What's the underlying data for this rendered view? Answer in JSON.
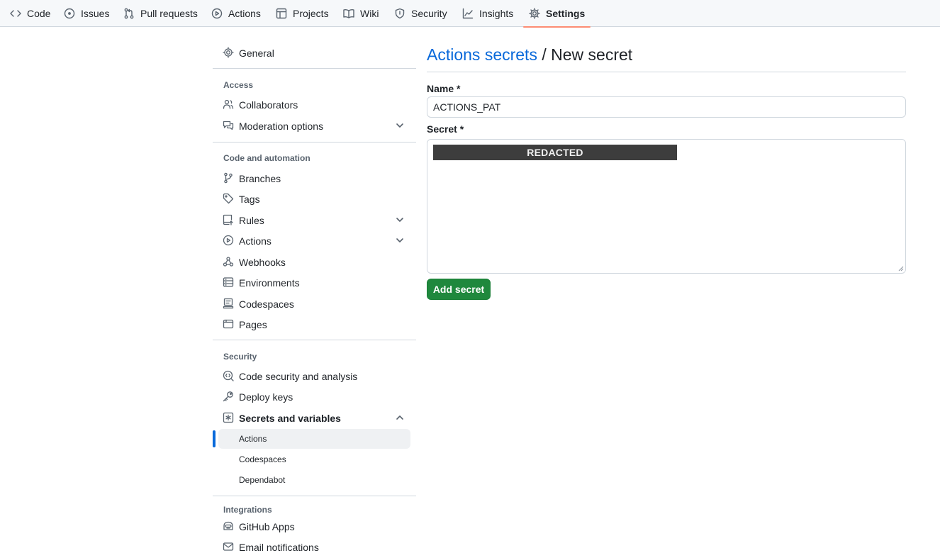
{
  "tabs": [
    {
      "label": "Code",
      "icon": "code-icon"
    },
    {
      "label": "Issues",
      "icon": "issue-icon"
    },
    {
      "label": "Pull requests",
      "icon": "pull-request-icon"
    },
    {
      "label": "Actions",
      "icon": "play-icon"
    },
    {
      "label": "Projects",
      "icon": "table-icon"
    },
    {
      "label": "Wiki",
      "icon": "book-icon"
    },
    {
      "label": "Security",
      "icon": "shield-icon"
    },
    {
      "label": "Insights",
      "icon": "graph-icon"
    },
    {
      "label": "Settings",
      "icon": "gear-icon"
    }
  ],
  "selected_tab": "Settings",
  "sidebar": {
    "general": "General",
    "access": {
      "heading": "Access",
      "collaborators": "Collaborators",
      "moderation": "Moderation options"
    },
    "code_automation": {
      "heading": "Code and automation",
      "branches": "Branches",
      "tags": "Tags",
      "rules": "Rules",
      "actions": "Actions",
      "webhooks": "Webhooks",
      "environments": "Environments",
      "codespaces": "Codespaces",
      "pages": "Pages"
    },
    "security": {
      "heading": "Security",
      "code_security": "Code security and analysis",
      "deploy_keys": "Deploy keys",
      "secrets_variables": "Secrets and variables",
      "sub": {
        "actions": "Actions",
        "codespaces": "Codespaces",
        "dependabot": "Dependabot"
      }
    },
    "integrations": {
      "heading": "Integrations",
      "github_apps": "GitHub Apps",
      "email_notifications": "Email notifications"
    }
  },
  "main": {
    "breadcrumb_link": "Actions secrets",
    "breadcrumb_sep": "/",
    "breadcrumb_current": "New secret",
    "name_label": "Name *",
    "name_value": "ACTIONS_PAT",
    "secret_label": "Secret *",
    "secret_redacted": "REDACTED",
    "submit_label": "Add secret"
  },
  "colors": {
    "accent_blue": "#0969da",
    "button_green": "#1f883d",
    "tab_underline": "#fd8c73"
  }
}
